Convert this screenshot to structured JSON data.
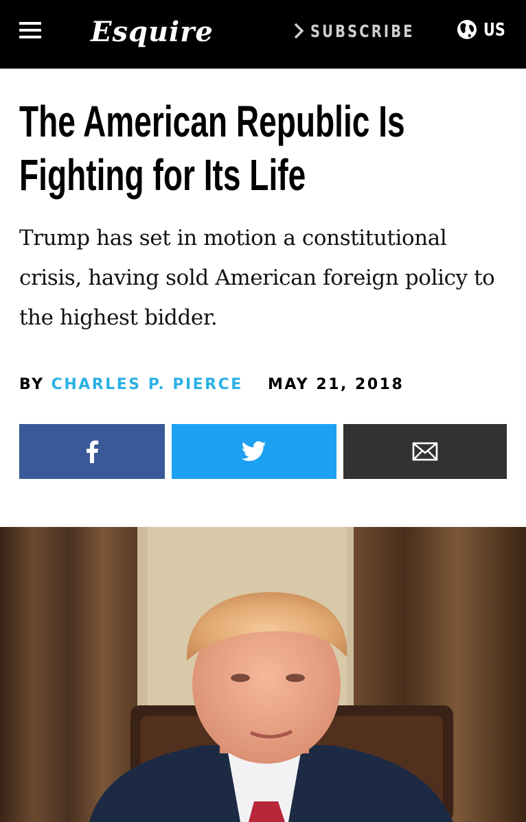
{
  "header": {
    "logo_text": "Esquire",
    "subscribe_label": "SUBSCRIBE",
    "edition_label": "US",
    "icons": [
      "menu-icon",
      "chevron-right-icon",
      "globe-icon"
    ]
  },
  "article": {
    "headline": "The American Republic Is Fighting for Its Life",
    "dek": "Trump has set in motion a constitutional crisis, having sold American foreign policy to the highest bidder.",
    "byline_prefix": "BY",
    "author": "CHARLES P. PIERCE",
    "date": "MAY 21, 2018"
  },
  "share": {
    "buttons": [
      {
        "network": "facebook",
        "icon": "facebook-icon",
        "color": "#3b5998"
      },
      {
        "network": "twitter",
        "icon": "twitter-icon",
        "color": "#1da1f2"
      },
      {
        "network": "email",
        "icon": "envelope-icon",
        "color": "#323232"
      }
    ]
  },
  "colors": {
    "header_bg": "#000000",
    "author_link": "#2bb0e5"
  }
}
